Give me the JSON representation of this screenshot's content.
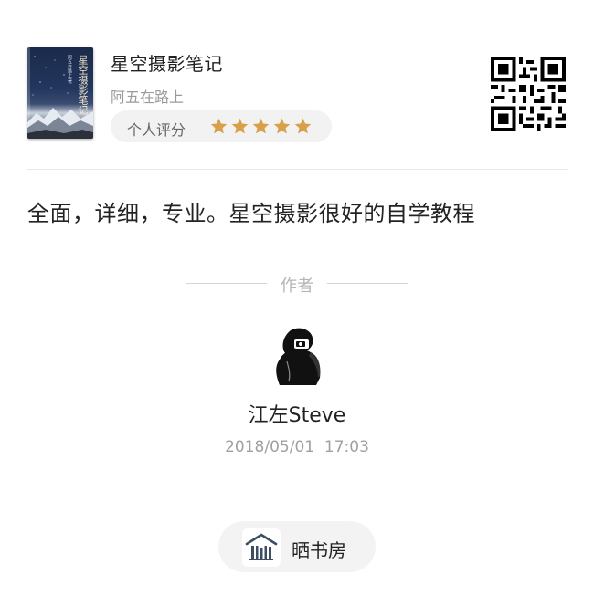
{
  "book": {
    "title": "星空摄影笔记",
    "author": "阿五在路上",
    "cover_title": "星空摄影笔记",
    "cover_author": "阿五在路上 著"
  },
  "rating": {
    "label": "个人评分",
    "stars": 5,
    "max_stars": 5,
    "star_color": "#d9a04a"
  },
  "review": {
    "text": "全面，详细，专业。星空摄影很好的自学教程"
  },
  "author_section": {
    "label": "作者",
    "name": "江左Steve",
    "datetime": "2018/05/01  17:03"
  },
  "action": {
    "label": "晒书房",
    "icon": "bookshelf-icon"
  }
}
